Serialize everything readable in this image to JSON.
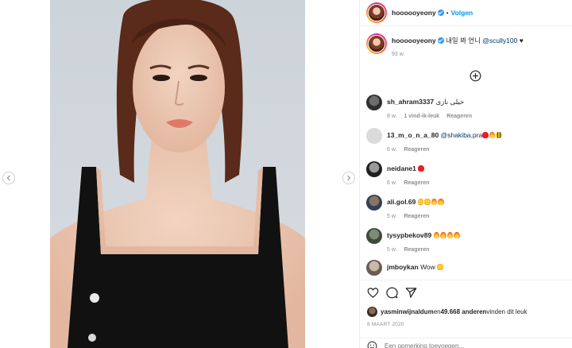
{
  "header": {
    "username": "hoooooyeony",
    "dot": "•",
    "follow_label": "Volgen"
  },
  "caption": {
    "username": "hoooooyeony",
    "text": "내일 봐 언니 ",
    "mention": "@scully100",
    "suffix": " ♥",
    "time": "93 w."
  },
  "comments": [
    {
      "username": "sh_ahram3337",
      "text": "خیلی نازی",
      "time": "8 w.",
      "likes": "1 vind-ik-leuk",
      "reply": "Reageren",
      "emojis": []
    },
    {
      "username": "13_m_o_n_a_80",
      "text": "@shakiba.pra",
      "time": "6 w.",
      "likes": "",
      "reply": "Reageren",
      "emojis": [
        "heart",
        "fire",
        "bee"
      ]
    },
    {
      "username": "neidane1",
      "text": "",
      "time": "6 w.",
      "likes": "",
      "reply": "Reageren",
      "emojis": [
        "heart"
      ]
    },
    {
      "username": "ali.gol.69",
      "text": "",
      "time": "5 w.",
      "likes": "",
      "reply": "Reageren",
      "emojis": [
        "starry",
        "starry",
        "fire",
        "fire"
      ]
    },
    {
      "username": "tysypbekov89",
      "text": "",
      "time": "5 w.",
      "likes": "",
      "reply": "Reageren",
      "emojis": [
        "fire",
        "fire",
        "fire",
        "fire"
      ]
    },
    {
      "username": "jmboykan",
      "text": "Wow ",
      "time": "",
      "likes": "",
      "reply": "",
      "emojis": [
        "starry"
      ]
    }
  ],
  "likes": {
    "user": "yasminwijnaldum",
    "mid": " en ",
    "count": "49.668 anderen",
    "suffix": " vinden dit leuk"
  },
  "date": "8 MAART 2020",
  "add_comment_placeholder": "Een opmerking toevoegen...",
  "icons": [
    "chevron-left-icon",
    "chevron-right-icon",
    "heart-icon",
    "comment-icon",
    "share-icon",
    "emoji-icon",
    "plus-circle-icon",
    "verified-icon"
  ],
  "colors": {
    "accent": "#0095f6",
    "verified": "#3897f0",
    "meta": "#8e8e8e"
  }
}
